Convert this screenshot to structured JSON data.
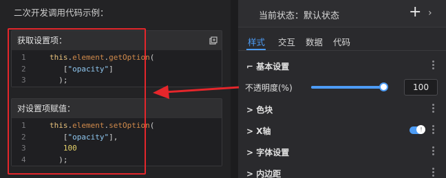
{
  "left": {
    "title": "二次开发调用代码示例：",
    "get_block": {
      "heading": "获取设置项：",
      "lines": [
        {
          "n": "1",
          "parts": [
            [
              "kw",
              "this"
            ],
            [
              "plain",
              "."
            ],
            [
              "fn",
              "element"
            ],
            [
              "plain",
              "."
            ],
            [
              "fn",
              "getOption"
            ],
            [
              "plain",
              "("
            ]
          ]
        },
        {
          "n": "2",
          "parts": [
            [
              "plain",
              "   ["
            ],
            [
              "str",
              "\"opacity\""
            ],
            [
              "plain",
              "]"
            ]
          ]
        },
        {
          "n": "3",
          "parts": [
            [
              "plain",
              "  );"
            ]
          ]
        }
      ]
    },
    "set_block": {
      "heading": "对设置项赋值：",
      "lines": [
        {
          "n": "1",
          "parts": [
            [
              "kw",
              "this"
            ],
            [
              "plain",
              "."
            ],
            [
              "fn",
              "element"
            ],
            [
              "plain",
              "."
            ],
            [
              "fn",
              "setOption"
            ],
            [
              "plain",
              "("
            ]
          ]
        },
        {
          "n": "2",
          "parts": [
            [
              "plain",
              "   ["
            ],
            [
              "str",
              "\"opacity\""
            ],
            [
              "plain",
              "],"
            ]
          ]
        },
        {
          "n": "3",
          "parts": [
            [
              "num",
              "   100"
            ]
          ]
        },
        {
          "n": "4",
          "parts": [
            [
              "plain",
              "  );"
            ]
          ]
        }
      ]
    }
  },
  "right": {
    "state_label": "当前状态：默认状态",
    "plus_glyph": "+",
    "chevron_glyph": "›",
    "tabs": [
      "样式",
      "交互",
      "数据",
      "代码"
    ],
    "active_tab": "样式",
    "base_settings": "基本设置",
    "opacity_label": "不透明度(%)",
    "opacity_value": "100",
    "opacity_fraction": 1.0,
    "sections": [
      "色块",
      "X轴",
      "字体设置",
      "内边距"
    ],
    "x_axis_toggle_on": true,
    "toggle_mark": "!",
    "collapse_glyph": "⌐",
    "expand_glyph": ">"
  },
  "colors": {
    "accent": "#4d9cf5",
    "highlight": "#e5262b"
  }
}
